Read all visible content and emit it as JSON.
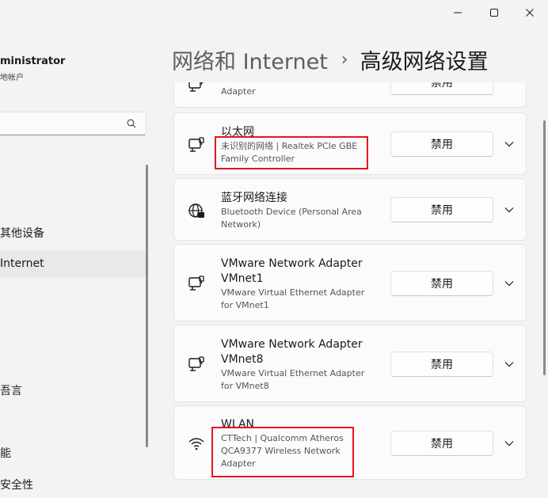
{
  "window_controls": [
    "minimize",
    "maximize",
    "close"
  ],
  "account": {
    "name": "ministrator",
    "type": "地帐户"
  },
  "sidebar": {
    "items": [
      {
        "label": "其他设备",
        "active": false
      },
      {
        "label": "Internet",
        "active": true
      },
      {
        "label": "吾言",
        "active": false
      },
      {
        "label": "能",
        "active": false
      },
      {
        "label": "安全性",
        "active": false
      }
    ]
  },
  "header": {
    "parent": "网络和 Internet",
    "separator": "›",
    "current": "高级网络设置"
  },
  "adapters": [
    {
      "icon": "ethernet-icon",
      "title": "",
      "desc_lines": [
        "Adapter"
      ]
    },
    {
      "icon": "ethernet-icon",
      "title": "以太网",
      "desc_lines": [
        "未识别的网络 | Realtek PCIe GBE",
        "Family Controller"
      ]
    },
    {
      "icon": "globe-icon",
      "title": "蓝牙网络连接",
      "desc_lines": [
        "Bluetooth Device (Personal Area",
        "Network)"
      ]
    },
    {
      "icon": "ethernet-icon",
      "title": "VMware Network Adapter VMnet1",
      "title_lines": [
        "VMware Network Adapter",
        "VMnet1"
      ],
      "desc_lines": [
        "VMware Virtual Ethernet Adapter",
        "for VMnet1"
      ]
    },
    {
      "icon": "ethernet-icon",
      "title": "VMware Network Adapter VMnet8",
      "title_lines": [
        "VMware Network Adapter",
        "VMnet8"
      ],
      "desc_lines": [
        "VMware Virtual Ethernet Adapter",
        "for VMnet8"
      ]
    },
    {
      "icon": "wifi-icon",
      "title": "WLAN",
      "desc_lines": [
        "CTTech | Qualcomm Atheros",
        "QCA9377 Wireless Network",
        "Adapter"
      ]
    }
  ],
  "disable_label": "禁用",
  "highlight_color": "#e8141b"
}
